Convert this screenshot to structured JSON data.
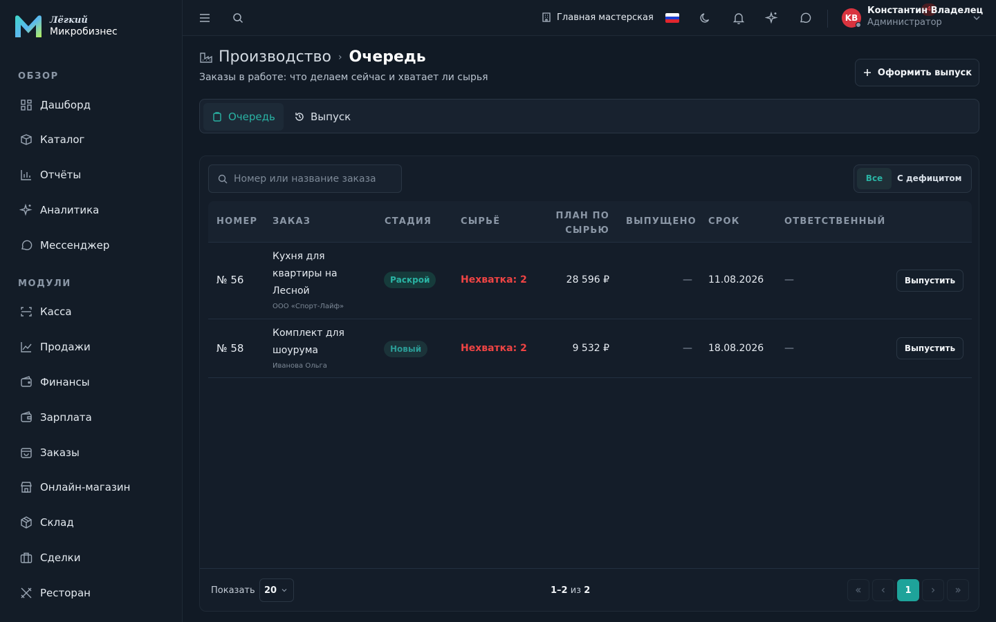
{
  "brand": {
    "top": "Лёгкий",
    "bottom": "Микробизнес"
  },
  "sidebar": {
    "sections": [
      {
        "title": "ОБЗОР"
      },
      {
        "title": "МОДУЛИ"
      }
    ],
    "items": [
      {
        "label": "Дашборд",
        "icon": "dashboard-icon"
      },
      {
        "label": "Каталог",
        "icon": "catalog-icon"
      },
      {
        "label": "Отчёты",
        "icon": "reports-icon"
      },
      {
        "label": "Аналитика",
        "icon": "analytics-icon"
      },
      {
        "label": "Мессенджер",
        "icon": "messenger-icon"
      },
      {
        "label": "Касса",
        "icon": "cashbox-icon"
      },
      {
        "label": "Продажи",
        "icon": "sales-icon"
      },
      {
        "label": "Финансы",
        "icon": "finance-icon"
      },
      {
        "label": "Зарплата",
        "icon": "salary-icon"
      },
      {
        "label": "Заказы",
        "icon": "orders-icon"
      },
      {
        "label": "Онлайн-магазин",
        "icon": "store-icon"
      },
      {
        "label": "Склад",
        "icon": "warehouse-icon"
      },
      {
        "label": "Сделки",
        "icon": "deals-icon"
      },
      {
        "label": "Ресторан",
        "icon": "restaurant-icon"
      }
    ]
  },
  "topbar": {
    "workspace": "Главная мастерская",
    "notifications_count": "4",
    "user": {
      "initials": "KB",
      "name": "Константин Владелец",
      "role": "Администратор"
    }
  },
  "header": {
    "crumb_parent": "Производство",
    "crumb_sep": "›",
    "crumb_current": "Очередь",
    "subtitle": "Заказы в работе: что делаем сейчас и хватает ли сырья",
    "release_button": "Оформить выпуск"
  },
  "tabs": {
    "queue": "Очередь",
    "release": "Выпуск"
  },
  "table": {
    "search_placeholder": "Номер или название заказа",
    "filters": {
      "all": "Все",
      "deficit": "С дефицитом"
    },
    "columns": {
      "number": "НОМЕР",
      "order": "ЗАКАЗ",
      "stage": "СТАДИЯ",
      "raw": "СЫРЬЁ",
      "plan_1": "ПЛАН ПО",
      "plan_2": "СЫРЬЮ",
      "released": "ВЫПУЩЕНО",
      "due": "СРОК",
      "owner": "ОТВЕТСТВЕННЫЙ"
    },
    "rows": [
      {
        "number": "№ 56",
        "name_lines": [
          "Кухня для",
          "квартиры на",
          "Лесной"
        ],
        "customer": "ООО «Спорт-Лайф»",
        "stage": "Раскрой",
        "raw": "Нехватка: 2",
        "plan": "28 596 ₽",
        "released": "—",
        "due": "11.08.2026",
        "owner": "—",
        "action": "Выпустить"
      },
      {
        "number": "№ 58",
        "name_lines": [
          "Комплект для",
          "шоурума"
        ],
        "customer": "Иванова Ольга",
        "stage": "Новый",
        "raw": "Нехватка: 2",
        "plan": "9 532 ₽",
        "released": "—",
        "due": "18.08.2026",
        "owner": "—",
        "action": "Выпустить"
      }
    ]
  },
  "pagination": {
    "show_label": "Показать",
    "page_size": "20",
    "range": "1–2",
    "of_label": "из",
    "total": "2",
    "current_page": "1"
  },
  "colors": {
    "accent": "#1ea39a",
    "danger": "#ef4444",
    "bg": "#111a25"
  }
}
